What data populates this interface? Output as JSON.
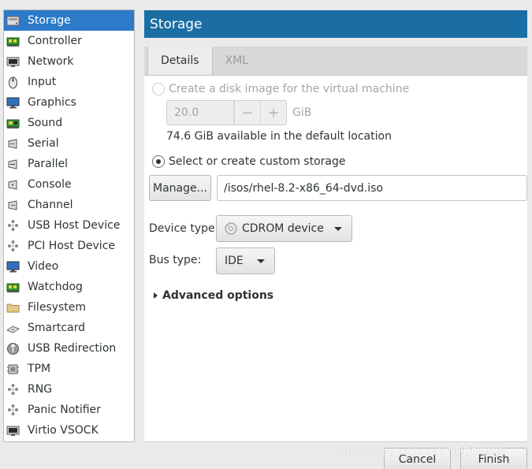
{
  "sidebar": {
    "items": [
      {
        "label": "Storage",
        "icon": "storage-icon",
        "selected": true
      },
      {
        "label": "Controller",
        "icon": "controller-icon"
      },
      {
        "label": "Network",
        "icon": "network-icon"
      },
      {
        "label": "Input",
        "icon": "mouse-icon"
      },
      {
        "label": "Graphics",
        "icon": "monitor-icon"
      },
      {
        "label": "Sound",
        "icon": "sound-card-icon"
      },
      {
        "label": "Serial",
        "icon": "serial-port-icon"
      },
      {
        "label": "Parallel",
        "icon": "parallel-port-icon"
      },
      {
        "label": "Console",
        "icon": "console-icon"
      },
      {
        "label": "Channel",
        "icon": "channel-icon"
      },
      {
        "label": "USB Host Device",
        "icon": "usb-device-icon"
      },
      {
        "label": "PCI Host Device",
        "icon": "pci-device-icon"
      },
      {
        "label": "Video",
        "icon": "video-monitor-icon"
      },
      {
        "label": "Watchdog",
        "icon": "watchdog-icon"
      },
      {
        "label": "Filesystem",
        "icon": "folder-icon"
      },
      {
        "label": "Smartcard",
        "icon": "smartcard-icon"
      },
      {
        "label": "USB Redirection",
        "icon": "usb-redirection-icon"
      },
      {
        "label": "TPM",
        "icon": "chip-icon"
      },
      {
        "label": "RNG",
        "icon": "rng-icon"
      },
      {
        "label": "Panic Notifier",
        "icon": "panic-notifier-icon"
      },
      {
        "label": "Virtio VSOCK",
        "icon": "vsock-icon"
      }
    ]
  },
  "header": {
    "title": "Storage"
  },
  "tabs": [
    {
      "label": "Details",
      "active": true
    },
    {
      "label": "XML",
      "active": false
    }
  ],
  "storage": {
    "create_disk_label": "Create a disk image for the virtual machine",
    "disk_size_value": "20.0",
    "disk_size_unit": "GiB",
    "minus_symbol": "−",
    "plus_symbol": "+",
    "available_text": "74.6 GiB available in the default location",
    "custom_storage_label": "Select or create custom storage",
    "manage_button_label": "Manage...",
    "path_value": "/isos/rhel-8.2-x86_64-dvd.iso",
    "device_type_label": "Device type:",
    "device_type_value": "CDROM device",
    "bus_type_label": "Bus type:",
    "bus_type_value": "IDE",
    "advanced_options_label": "Advanced options"
  },
  "footer": {
    "cancel_label": "Cancel",
    "finish_label": "Finish"
  },
  "watermark": "https://blog.csdn.net/WHDGOUJA",
  "colors": {
    "selection": "#2d7bc8",
    "header": "#1b6ea4"
  }
}
